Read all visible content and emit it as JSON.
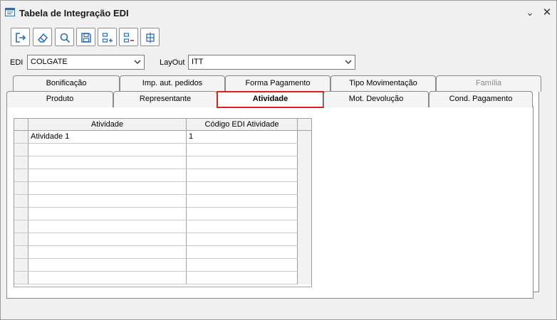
{
  "window": {
    "title": "Tabela de Integração EDI",
    "minimize_glyph": "⌄",
    "close_glyph": "✕"
  },
  "toolbar": {
    "buttons": [
      {
        "name": "exit-button",
        "icon": "exit-icon"
      },
      {
        "name": "clear-button",
        "icon": "eraser-icon"
      },
      {
        "name": "search-button",
        "icon": "search-icon"
      },
      {
        "name": "save-button",
        "icon": "save-icon"
      },
      {
        "name": "add-row-button",
        "icon": "add-row-icon"
      },
      {
        "name": "remove-row-button",
        "icon": "remove-row-icon"
      },
      {
        "name": "table-button",
        "icon": "table-icon"
      }
    ]
  },
  "filters": {
    "edi_label": "EDI",
    "edi_value": "COLGATE",
    "layout_label": "LayOut",
    "layout_value": "ITT"
  },
  "tabs": {
    "row1": [
      "Bonificação",
      "Imp. aut. pedidos",
      "Forma Pagamento",
      "Tipo Movimentação",
      "Família"
    ],
    "row2": [
      "Produto",
      "Representante",
      "Atividade",
      "Mot. Devolução",
      "Cond. Pagamento"
    ],
    "active": "Atividade",
    "disabled": "Família"
  },
  "grid": {
    "columns": [
      "Atividade",
      "Código EDI Atividade"
    ],
    "rows": [
      [
        "Atividade 1",
        "1"
      ],
      [
        "",
        ""
      ],
      [
        "",
        ""
      ],
      [
        "",
        ""
      ],
      [
        "",
        ""
      ],
      [
        "",
        ""
      ],
      [
        "",
        ""
      ],
      [
        "",
        ""
      ],
      [
        "",
        ""
      ],
      [
        "",
        ""
      ],
      [
        "",
        ""
      ],
      [
        "",
        ""
      ]
    ]
  },
  "colors": {
    "active_tab_border": "#e01e1e",
    "icon_blue": "#2a6ebb",
    "icon_red": "#d33a2c"
  }
}
